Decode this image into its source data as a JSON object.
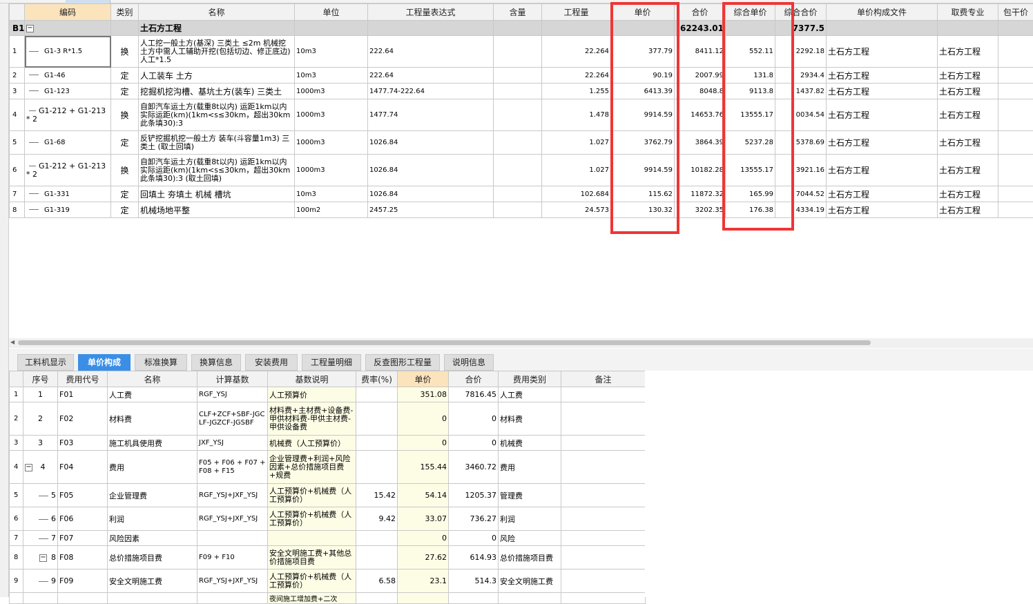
{
  "upper_table": {
    "headers": [
      "编码",
      "类别",
      "名称",
      "单位",
      "工程量表达式",
      "含量",
      "工程量",
      "单价",
      "合价",
      "综合单价",
      "综合合价",
      "单价构成文件",
      "取费专业",
      "包干价"
    ],
    "group": {
      "id": "B1",
      "name": "土石方工程",
      "total_price": "62243.01",
      "total_comprehensive": "7377.5"
    },
    "rows": [
      {
        "no": "1",
        "code": "G1-3 R*1.5",
        "type": "换",
        "name": "人工挖一般土方(基深) 三类土 ≤2m 机械挖土方中需人工辅助开挖(包括切边、修正底边) 人工*1.5",
        "unit": "10m3",
        "expr": "222.64",
        "qty": "22.264",
        "price": "377.79",
        "total": "8411.12",
        "cprice": "552.11",
        "ctotal": "2292.18",
        "file": "土石方工程",
        "spec": "土石方工程"
      },
      {
        "no": "2",
        "code": "G1-46",
        "type": "定",
        "name": "人工装车 土方",
        "unit": "10m3",
        "expr": "222.64",
        "qty": "22.264",
        "price": "90.19",
        "total": "2007.99",
        "cprice": "131.8",
        "ctotal": "2934.4",
        "file": "土石方工程",
        "spec": "土石方工程"
      },
      {
        "no": "3",
        "code": "G1-123",
        "type": "定",
        "name": "挖掘机挖沟槽、基坑土方(装车) 三类土",
        "unit": "1000m3",
        "expr": "1477.74-222.64",
        "qty": "1.255",
        "price": "6413.39",
        "total": "8048.8",
        "cprice": "9113.8",
        "ctotal": "1437.82",
        "file": "土石方工程",
        "spec": "土石方工程"
      },
      {
        "no": "4",
        "code": "G1-212 + G1-213 * 2",
        "type": "换",
        "name": "自卸汽车运土方(载重8t以内) 运距1km以内 实际运距(km)(1km<s≤30km，超出30km此条填30):3",
        "unit": "1000m3",
        "expr": "1477.74",
        "qty": "1.478",
        "price": "9914.59",
        "total": "14653.76",
        "cprice": "13555.17",
        "ctotal": "0034.54",
        "file": "土石方工程",
        "spec": "土石方工程"
      },
      {
        "no": "5",
        "code": "G1-68",
        "type": "定",
        "name": "反铲挖掘机挖一般土方 装车(斗容量1m3) 三类土 (取土回填)",
        "unit": "1000m3",
        "expr": "1026.84",
        "qty": "1.027",
        "price": "3762.79",
        "total": "3864.39",
        "cprice": "5237.28",
        "ctotal": "5378.69",
        "file": "土石方工程",
        "spec": "土石方工程"
      },
      {
        "no": "6",
        "code": "G1-212 + G1-213 * 2",
        "type": "换",
        "name": "自卸汽车运土方(载重8t以内) 运距1km以内 实际运距(km)(1km<s≤30km，超出30km此条填30):3 (取土回填)",
        "unit": "1000m3",
        "expr": "1026.84",
        "qty": "1.027",
        "price": "9914.59",
        "total": "10182.28",
        "cprice": "13555.17",
        "ctotal": "3921.16",
        "file": "土石方工程",
        "spec": "土石方工程"
      },
      {
        "no": "7",
        "code": "G1-331",
        "type": "定",
        "name": "回填土 夯填土 机械 槽坑",
        "unit": "10m3",
        "expr": "1026.84",
        "qty": "102.684",
        "price": "115.62",
        "total": "11872.32",
        "cprice": "165.99",
        "ctotal": "7044.52",
        "file": "土石方工程",
        "spec": "土石方工程"
      },
      {
        "no": "8",
        "code": "G1-319",
        "type": "定",
        "name": "机械场地平整",
        "unit": "100m2",
        "expr": "2457.25",
        "qty": "24.573",
        "price": "130.32",
        "total": "3202.35",
        "cprice": "176.38",
        "ctotal": "4334.19",
        "file": "土石方工程",
        "spec": "土石方工程"
      }
    ]
  },
  "tabs": [
    "工料机显示",
    "单价构成",
    "标准换算",
    "换算信息",
    "安装费用",
    "工程量明细",
    "反查图形工程量",
    "说明信息"
  ],
  "active_tab": "单价构成",
  "lower_table": {
    "headers": [
      "序号",
      "费用代号",
      "名称",
      "计算基数",
      "基数说明",
      "费率(%)",
      "单价",
      "合价",
      "费用类别",
      "备注"
    ],
    "rows": [
      {
        "rn": "1",
        "seq": "1",
        "code": "F01",
        "name": "人工费",
        "base": "RGF_YSJ",
        "desc": "人工预算价",
        "rate": "",
        "price": "351.08",
        "total": "7816.45",
        "cat": "人工费"
      },
      {
        "rn": "2",
        "seq": "2",
        "code": "F02",
        "name": "材料费",
        "base": "CLF+ZCF+SBF-JGCLF-JGZCF-JGSBF",
        "desc": "材料费+主材费+设备费-甲供材料费-甲供主材费-甲供设备费",
        "rate": "",
        "price": "0",
        "total": "0",
        "cat": "材料费"
      },
      {
        "rn": "3",
        "seq": "3",
        "code": "F03",
        "name": "施工机具使用费",
        "base": "JXF_YSJ",
        "desc": "机械费（人工预算价）",
        "rate": "",
        "price": "0",
        "total": "0",
        "cat": "机械费"
      },
      {
        "rn": "4",
        "seq": "4",
        "code": "F04",
        "name": "费用",
        "base": "F05 + F06 + F07 + F08 + F15",
        "desc": "企业管理费+利润+风险因素+总价措施项目费+规费",
        "rate": "",
        "price": "155.44",
        "total": "3460.72",
        "cat": "费用"
      },
      {
        "rn": "5",
        "seq": "5",
        "code": "F05",
        "name": "企业管理费",
        "base": "RGF_YSJ+JXF_YSJ",
        "desc": "人工预算价+机械费（人工预算价）",
        "rate": "15.42",
        "price": "54.14",
        "total": "1205.37",
        "cat": "管理费"
      },
      {
        "rn": "6",
        "seq": "6",
        "code": "F06",
        "name": "利润",
        "base": "RGF_YSJ+JXF_YSJ",
        "desc": "人工预算价+机械费（人工预算价）",
        "rate": "9.42",
        "price": "33.07",
        "total": "736.27",
        "cat": "利润"
      },
      {
        "rn": "7",
        "seq": "7",
        "code": "F07",
        "name": "风险因素",
        "base": "",
        "desc": "",
        "rate": "",
        "price": "0",
        "total": "0",
        "cat": "风险"
      },
      {
        "rn": "8",
        "seq": "8",
        "code": "F08",
        "name": "总价措施项目费",
        "base": "F09 + F10",
        "desc": "安全文明施工费+其他总价措施项目费",
        "rate": "",
        "price": "27.62",
        "total": "614.93",
        "cat": "总价措施项目费"
      },
      {
        "rn": "9",
        "seq": "9",
        "code": "F09",
        "name": "安全文明施工费",
        "base": "RGF_YSJ+JXF_YSJ",
        "desc": "人工预算价+机械费（人工预算价）",
        "rate": "6.58",
        "price": "23.1",
        "total": "514.3",
        "cat": "安全文明施工费"
      },
      {
        "rn": "",
        "seq": "",
        "code": "",
        "name": "",
        "base": "",
        "desc": "夜间施工增加费+二次",
        "rate": "",
        "price": "",
        "total": "",
        "cat": ""
      }
    ]
  }
}
